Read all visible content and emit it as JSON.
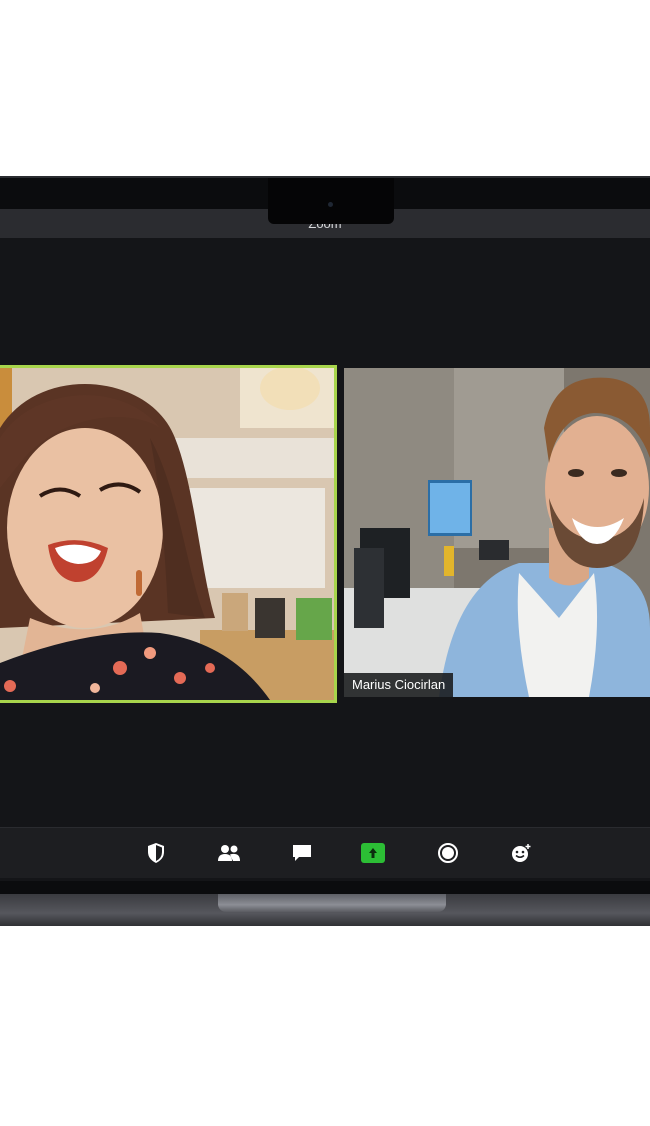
{
  "window": {
    "title": "Zoom"
  },
  "participants": [
    {
      "name": ""
    },
    {
      "name": "Marius Ciocirlan"
    }
  ],
  "toolbar": {
    "buttons": [
      {
        "icon": "shield-icon",
        "label": "Security"
      },
      {
        "icon": "participants-icon",
        "label": "Participants"
      },
      {
        "icon": "chat-icon",
        "label": "Chat"
      },
      {
        "icon": "share-screen-icon",
        "label": "Share Screen"
      },
      {
        "icon": "record-icon",
        "label": "Record"
      },
      {
        "icon": "reactions-icon",
        "label": "Reactions"
      }
    ]
  },
  "colors": {
    "active_speaker_border": "#a8d54c",
    "share_button": "#2cbe35",
    "toolbar_bg": "#1d1e21",
    "meeting_bg": "#141518"
  }
}
